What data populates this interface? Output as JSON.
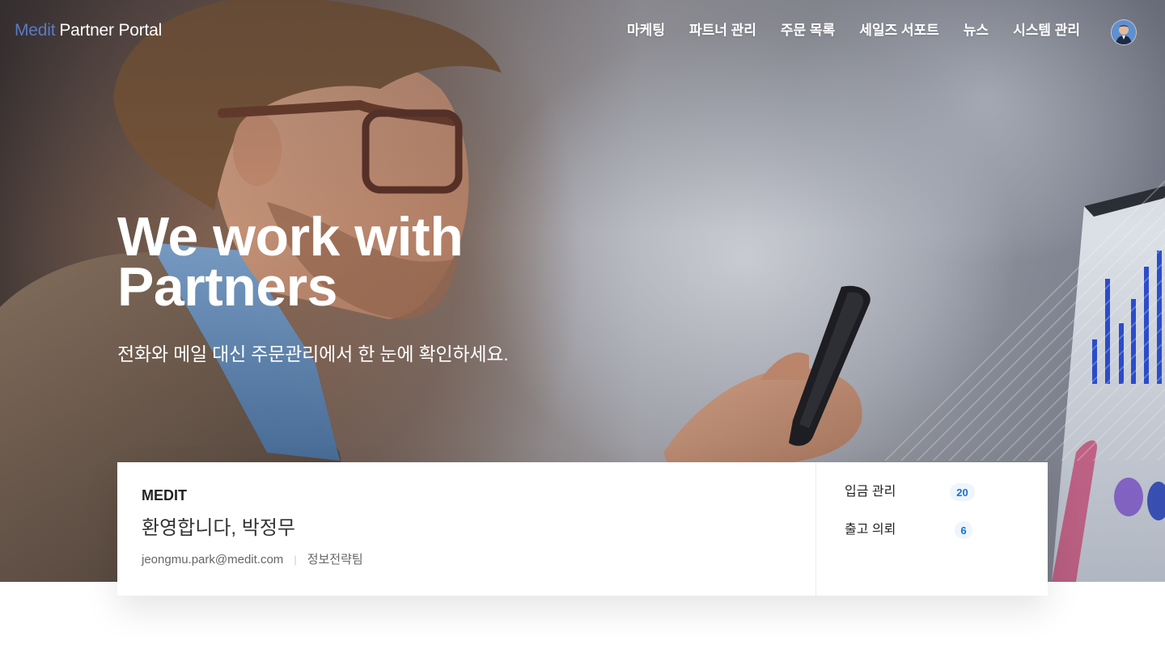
{
  "header": {
    "brand_medit": "Medit",
    "brand_rest": "Partner Portal",
    "nav": [
      {
        "label": "마케팅"
      },
      {
        "label": "파트너 관리"
      },
      {
        "label": "주문 목록"
      },
      {
        "label": "세일즈 서포트"
      },
      {
        "label": "뉴스"
      },
      {
        "label": "시스템 관리"
      }
    ]
  },
  "hero": {
    "headline_line1": "We work with",
    "headline_line2": "Partners",
    "subline": "전화와 메일 대신 주문관리에서 한 눈에 확인하세요."
  },
  "profile": {
    "company": "MEDIT",
    "welcome": "환영합니다, 박정무",
    "email": "jeongmu.park@medit.com",
    "separator": "|",
    "department": "정보전략팀"
  },
  "stats": [
    {
      "label": "입금 관리",
      "count": "20"
    },
    {
      "label": "출고 의뢰",
      "count": "6"
    }
  ]
}
